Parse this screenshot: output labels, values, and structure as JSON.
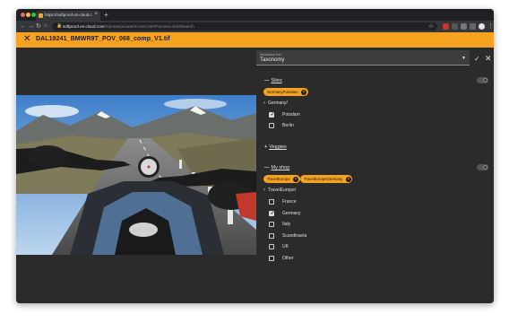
{
  "browser": {
    "tab_title": "https://softproof.es-cloud.com",
    "tab_close": "×",
    "new_tab": "+",
    "url_host": "softproof.es-cloud.com",
    "url_path": "/#/portal/private/Screen.html?screen=ES#/search",
    "url_scheme": "https://",
    "colors": {
      "close": "#ff5f57",
      "minimize": "#febc2e",
      "maximize": "#28c840"
    }
  },
  "header": {
    "close_glyph": "✕",
    "file_title": "DAL19241_BMWR9T_POV_068_comp_V1.tif",
    "accent": "#f4a21f"
  },
  "metadata_select": {
    "label": "Metadata Set",
    "value": "Taxonomy",
    "confirm": "✓",
    "cancel": "✕"
  },
  "sites": {
    "title": "Sites",
    "expand_symbol": "—",
    "chips": [
      "GermanyPotsdam"
    ],
    "crumb": "Germany/",
    "options": [
      {
        "label": "Potsdam",
        "checked": true
      },
      {
        "label": "Berlin",
        "checked": false
      }
    ]
  },
  "vegetables": {
    "title": "Veggies",
    "expand_symbol": "+"
  },
  "my_shop": {
    "title": "My shop",
    "expand_symbol": "—",
    "chips": [
      "TravelEurope",
      "TravelEuropeGermany"
    ],
    "crumb": "TravelEurope/",
    "options": [
      {
        "label": "France",
        "checked": false
      },
      {
        "label": "Germany",
        "checked": true
      },
      {
        "label": "Italy",
        "checked": false
      },
      {
        "label": "Scandinavia",
        "checked": false
      },
      {
        "label": "UK",
        "checked": false
      },
      {
        "label": "Other",
        "checked": false
      }
    ]
  }
}
